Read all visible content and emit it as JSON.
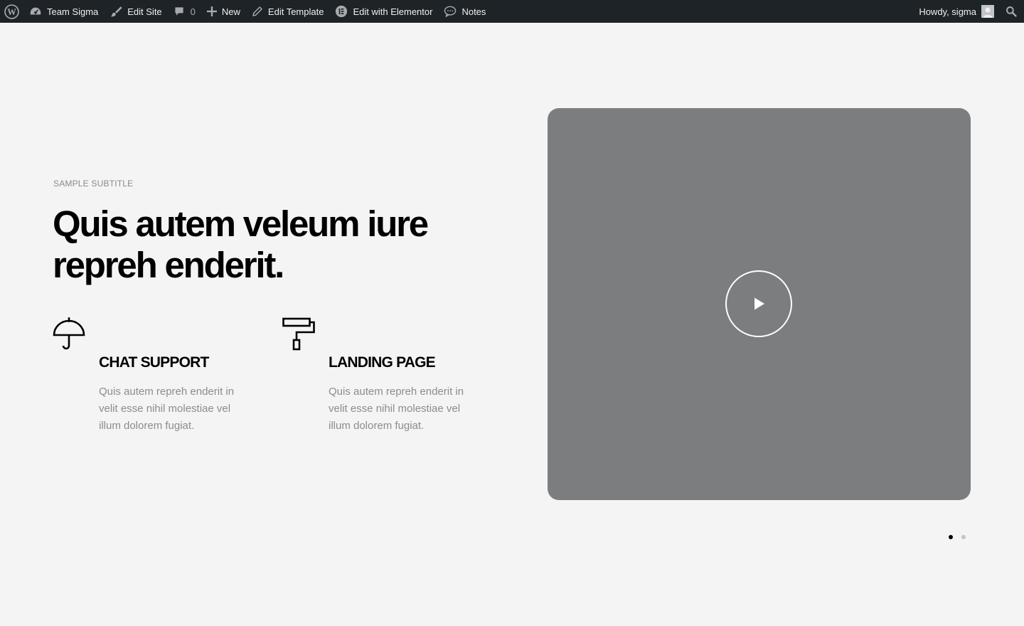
{
  "admin_bar": {
    "site_name": "Team Sigma",
    "edit_site": "Edit Site",
    "comments_count": "0",
    "new": "New",
    "edit_template": "Edit Template",
    "edit_with_elementor": "Edit with Elementor",
    "notes": "Notes",
    "howdy": "Howdy, sigma"
  },
  "hero": {
    "subtitle": "SAMPLE SUBTITLE",
    "headline": "Quis autem veleum iure repreh enderit."
  },
  "features": [
    {
      "icon": "umbrella-icon",
      "title": "CHAT SUPPORT",
      "text": "Quis autem repreh enderit in velit esse nihil molestiae vel illum dolorem fugiat."
    },
    {
      "icon": "paint-roller-icon",
      "title": "LANDING PAGE",
      "text": "Quis autem repreh enderit in velit esse nihil molestiae vel illum dolorem fugiat."
    }
  ],
  "video": {
    "play_icon": "play-icon",
    "background": "#7c7d7f"
  },
  "slider": {
    "slide_count": 2,
    "active_index": 0
  },
  "colors": {
    "admin_bar": "#1d2327",
    "page_background": "#f4f4f4",
    "muted_text": "#8c8c8c"
  }
}
